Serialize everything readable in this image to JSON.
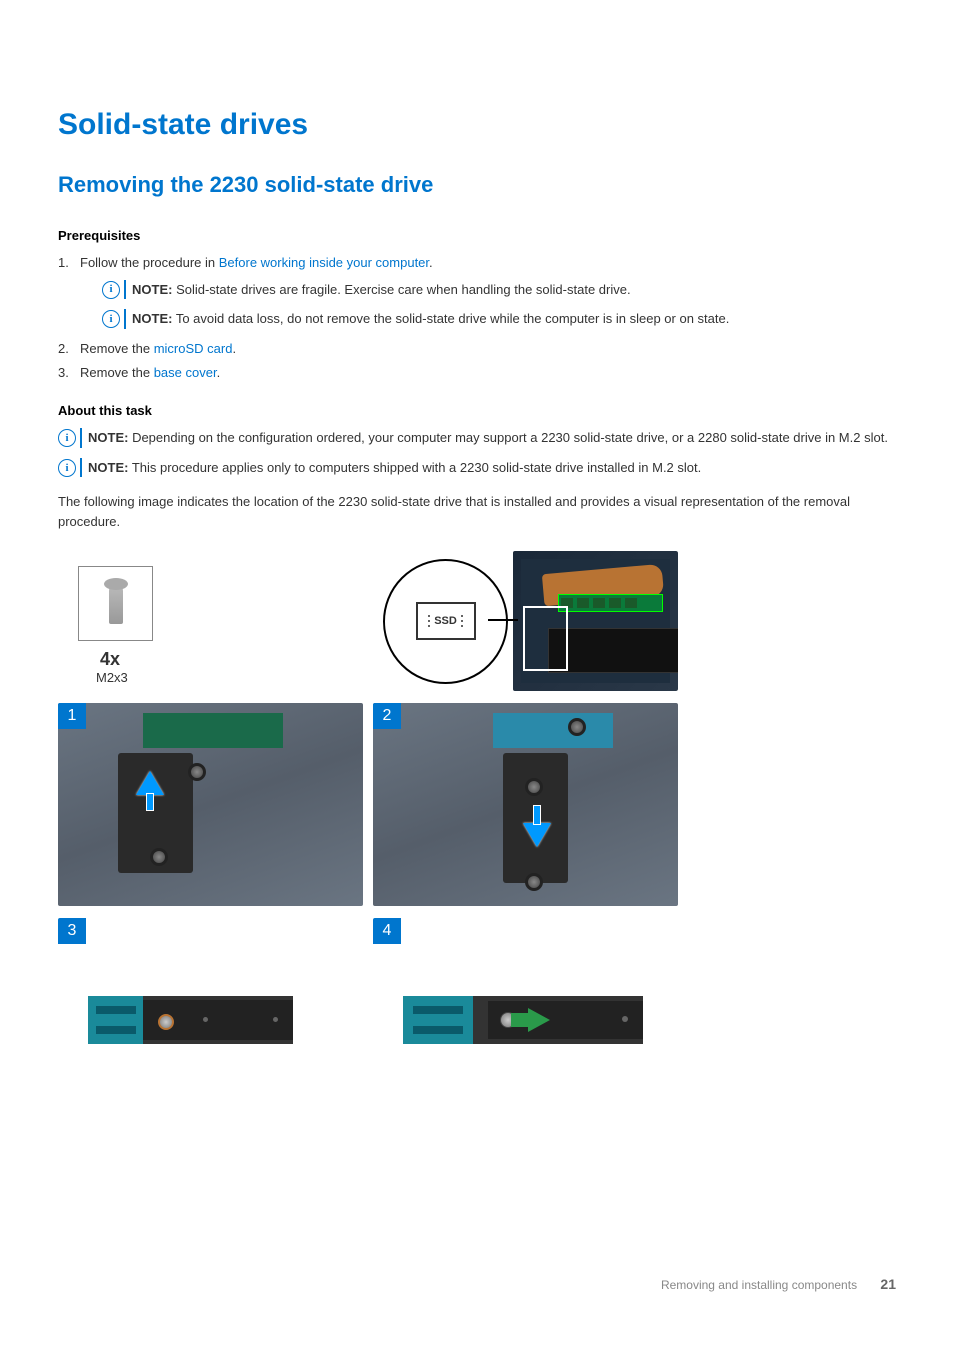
{
  "title": "Solid-state drives",
  "subtitle": "Removing the 2230 solid-state drive",
  "prereq_head": "Prerequisites",
  "steps": {
    "s1_pre": "Follow the procedure in ",
    "s1_link": "Before working inside your computer",
    "s1_post": ".",
    "s2_pre": "Remove the ",
    "s2_link": "microSD card",
    "s2_post": ".",
    "s3_pre": "Remove the ",
    "s3_link": "base cover",
    "s3_post": "."
  },
  "notes": {
    "label": "NOTE:",
    "n1": " Solid-state drives are fragile. Exercise care when handling the solid-state drive.",
    "n2": " To avoid data loss, do not remove the solid-state drive while the computer is in sleep or on state.",
    "n3": " Depending on the configuration ordered, your computer may support a 2230 solid-state drive, or a 2280 solid-state drive in M.2 slot.",
    "n4": " This procedure applies only to computers shipped with a 2230 solid-state drive installed in M.2 slot."
  },
  "about_head": "About this task",
  "about_para": "The following image indicates the location of the 2230 solid-state drive that is installed and provides a visual representation of the removal procedure.",
  "screw": {
    "count": "4x",
    "type": "M2x3"
  },
  "ssd_label": "SSD",
  "img_steps": {
    "a": "1",
    "b": "2",
    "c": "3",
    "d": "4"
  },
  "footer": {
    "section": "Removing and installing components",
    "page": "21"
  }
}
